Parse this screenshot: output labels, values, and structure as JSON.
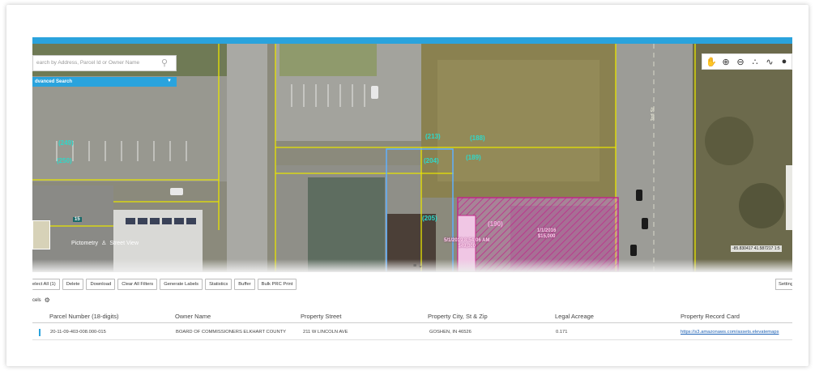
{
  "search": {
    "placeholder": "earch by Address, Parcel Id or Owner Name"
  },
  "advanced_search": {
    "label": "dvanced Search"
  },
  "map": {
    "pictometry_label": "Pictometry",
    "streetview_label": "Street View",
    "coords": "-85.830417 41.587217   1:5",
    "parcel_labels": [
      "(249)",
      "(250)",
      "(213)",
      "(188)",
      "(189)",
      "(204)",
      "(205)",
      "(190)"
    ],
    "sale_labels": [
      {
        "date": "5/1/2019 8:54:06 AM",
        "price": "$49,000"
      },
      {
        "date": "1/1/2016",
        "price": "$15,000"
      }
    ],
    "street_label": "3rd St",
    "tag_label": "15"
  },
  "actions": {
    "select_all": "elect All (1)",
    "delete": "Delete",
    "download": "Download",
    "clear_filters": "Clear All Filters",
    "generate_labels": "Generate Labels",
    "statistics": "Statistics",
    "buffer": "Buffer",
    "bulk_prc": "Bulk PRC Print",
    "settings": "Settings"
  },
  "parcels_label": "cels",
  "table": {
    "headers": [
      "Parcel Number (18-digits)",
      "Owner Name",
      "Property Street",
      "Property City, St & Zip",
      "Legal Acreage",
      "Property Record Card"
    ],
    "rows": [
      [
        "20-11-09-403-008.000-015",
        "BOARD OF COMMISSIONERS ELKHART COUNTY",
        "211 W LINCOLN AVE",
        "GOSHEN, IN 46526",
        "0.171",
        "https://s3.amazonaws.com/assets.elevatemaps"
      ]
    ]
  },
  "colors": {
    "accent": "#2aa3dd",
    "parcel_line": "#e8e400",
    "selected_parcel": "#5fb0ff",
    "sale_parcel": "#c0288a"
  }
}
